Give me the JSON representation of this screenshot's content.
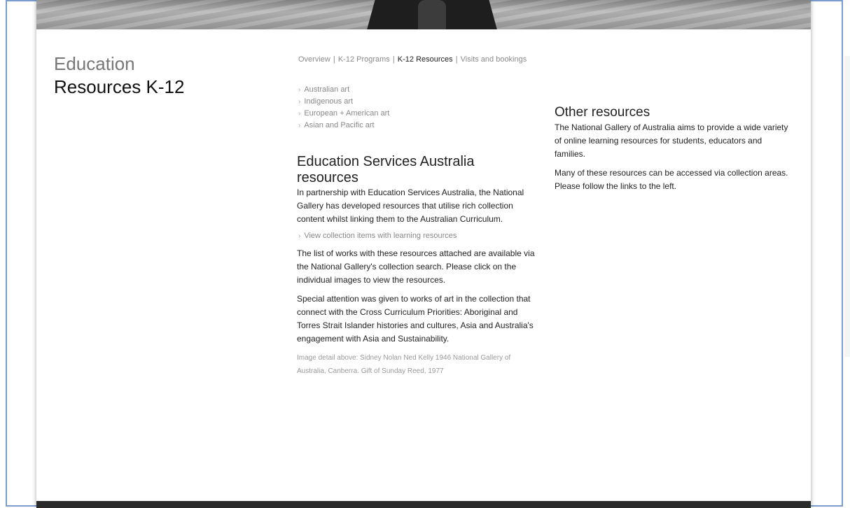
{
  "section": {
    "title": "Education",
    "subtitle": "Resources K-12"
  },
  "nav": {
    "items": [
      {
        "label": "Overview",
        "active": false
      },
      {
        "label": "K-12 Programs",
        "active": false
      },
      {
        "label": "K-12 Resources",
        "active": true
      },
      {
        "label": "Visits and bookings",
        "active": false
      }
    ],
    "separator": "|"
  },
  "categories": [
    "Australian art",
    "Indigenous art",
    "European + American art",
    "Asian and Pacific art"
  ],
  "main": {
    "heading": "Education Services Australia resources",
    "intro": "In partnership with Education Services Australia, the National Gallery has developed resources that utilise rich collection content whilst linking them to the Australian Curriculum.",
    "link_label": "View collection items with learning resources",
    "para2": "The list of works with these resources attached are available via the National Gallery's collection search. Please click on the individual images to view the resources.",
    "para3": "Special attention was given to works of art in the collection that connect with the Cross Curriculum Priorities: Aboriginal and Torres Strait Islander histories and cultures, Asia and Australia's engagement with Asia and Sustainability.",
    "credit": "Image detail above: Sidney Nolan Ned Kelly 1946 National Gallery of Australia, Canberra. Gift of Sunday Reed, 1977"
  },
  "side": {
    "heading": "Other resources",
    "para1": "The National Gallery of Australia aims to provide a wide variety of online learning resources for students, educators and families.",
    "para2": "Many of these resources can be accessed via collection areas. Please follow the links to the left."
  },
  "icons": {
    "list_bullet": "chevron-right-icon"
  },
  "colors": {
    "frame_border": "#7b9ccf",
    "footer": "#2a2a2a",
    "muted_text": "#888888"
  }
}
